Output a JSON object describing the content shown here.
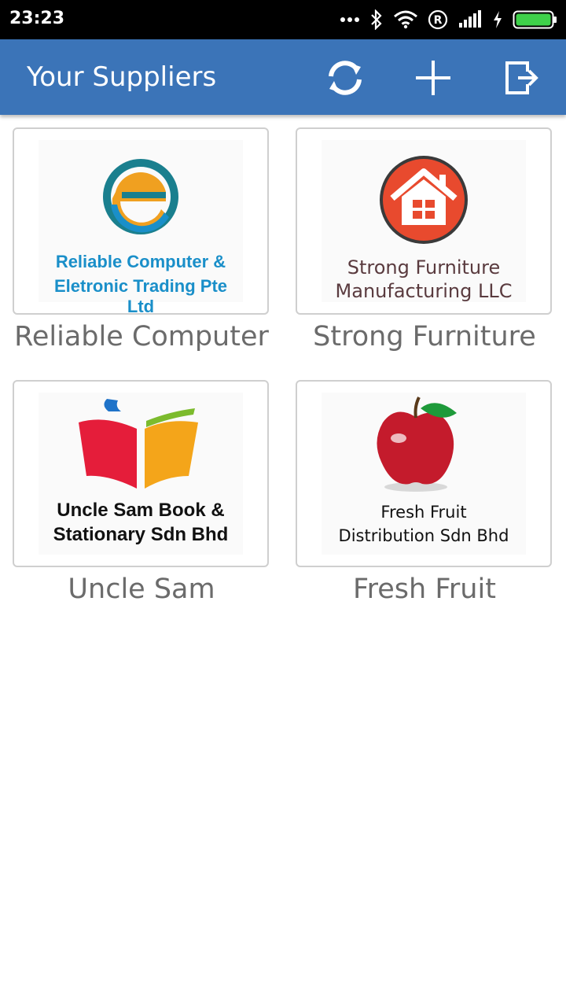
{
  "status_bar": {
    "time": "23:23"
  },
  "app_bar": {
    "title": "Your Suppliers",
    "actions": [
      {
        "name": "refresh-icon"
      },
      {
        "name": "plus-icon"
      },
      {
        "name": "logout-icon"
      }
    ]
  },
  "suppliers": [
    {
      "caption": "Reliable Computer",
      "logo_line1": "Reliable Computer &",
      "logo_line2": "Eletronic Trading Pte Ltd",
      "logo_color": "#1a8fc9"
    },
    {
      "caption": "Strong Furniture",
      "logo_line1": "Strong Furniture",
      "logo_line2": "Manufacturing LLC",
      "logo_color": "#5a3b3f"
    },
    {
      "caption": "Uncle Sam",
      "logo_line1": "Uncle Sam Book &",
      "logo_line2": "Stationary Sdn Bhd",
      "logo_color": "#111111"
    },
    {
      "caption": "Fresh Fruit",
      "logo_line1": "Fresh Fruit",
      "logo_line2": "Distribution Sdn Bhd",
      "logo_color": "#111111"
    }
  ],
  "colors": {
    "app_bar": "#3b74b8",
    "status_bar": "#000000"
  }
}
